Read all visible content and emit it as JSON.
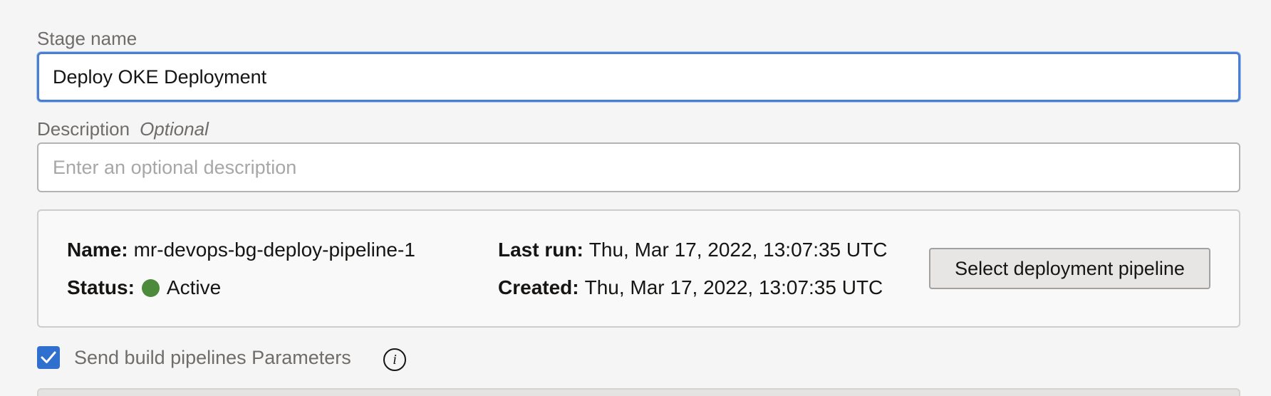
{
  "form": {
    "stage_name": {
      "label": "Stage name",
      "value": "Deploy OKE Deployment"
    },
    "description": {
      "label": "Description",
      "optional_tag": "Optional",
      "placeholder": "Enter an optional description",
      "value": ""
    }
  },
  "pipeline_card": {
    "name_key": "Name:",
    "name_value": "mr-devops-bg-deploy-pipeline-1",
    "status_key": "Status:",
    "status_value": "Active",
    "status_color": "#4c8a3c",
    "last_run_key": "Last run:",
    "last_run_value": "Thu, Mar 17, 2022, 13:07:35 UTC",
    "created_key": "Created:",
    "created_value": "Thu, Mar 17, 2022, 13:07:35 UTC",
    "select_button_label": "Select deployment pipeline"
  },
  "send_params": {
    "checked": true,
    "label": "Send build pipelines Parameters",
    "info_icon_glyph": "i"
  },
  "colors": {
    "accent": "#2f70cf",
    "focus_border": "#4a7fd0"
  }
}
